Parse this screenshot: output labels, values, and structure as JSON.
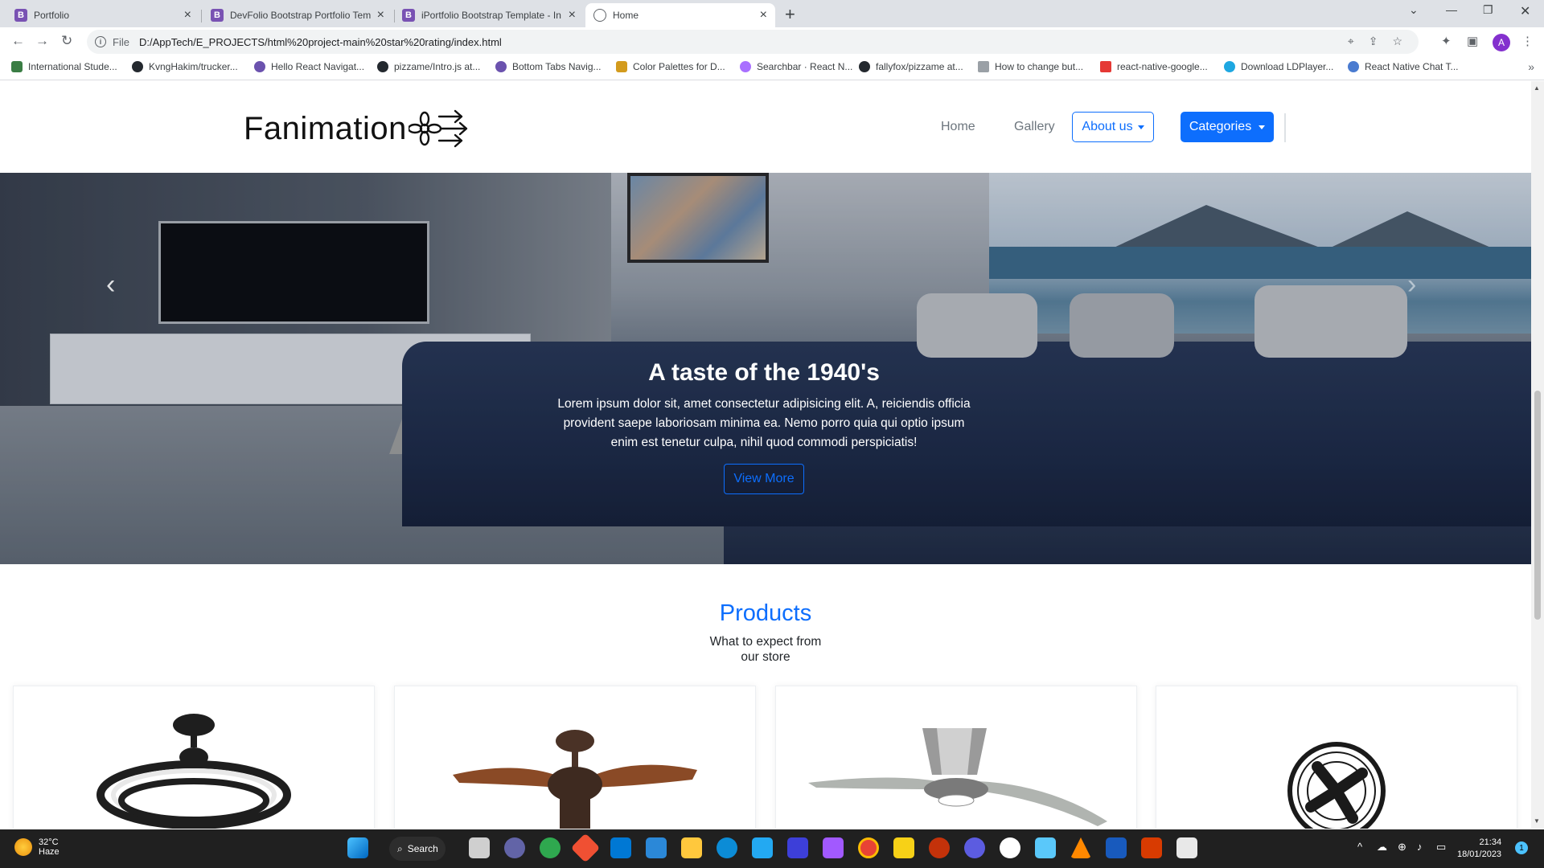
{
  "browser": {
    "tabs": [
      {
        "label": "Portfolio",
        "favicon": "B"
      },
      {
        "label": "DevFolio Bootstrap Portfolio Tem",
        "favicon": "B"
      },
      {
        "label": "iPortfolio Bootstrap Template - In",
        "favicon": "B"
      },
      {
        "label": "Home",
        "favicon": "globe"
      }
    ],
    "new_tab": "+",
    "address": {
      "scheme": "File",
      "url": "D:/AppTech/E_PROJECTS/html%20project-main%20star%20rating/index.html"
    },
    "profile_initial": "A",
    "bookmarks": [
      {
        "label": "International Stude...",
        "color": "#3a7d44"
      },
      {
        "label": "KvngHakim/trucker...",
        "color": "#24292f"
      },
      {
        "label": "Hello React Navigat...",
        "color": "#6b52ae"
      },
      {
        "label": "pizzame/Intro.js at...",
        "color": "#24292f"
      },
      {
        "label": "Bottom Tabs Navig...",
        "color": "#6b52ae"
      },
      {
        "label": "Color Palettes for D...",
        "color": "#d39b1d"
      },
      {
        "label": "Searchbar · React N...",
        "color": "#a970ff"
      },
      {
        "label": "fallyfox/pizzame at...",
        "color": "#24292f"
      },
      {
        "label": "How to change but...",
        "color": "#9aa0a6"
      },
      {
        "label": "react-native-google...",
        "color": "#e53935"
      },
      {
        "label": "Download LDPlayer...",
        "color": "#1ea7e1"
      },
      {
        "label": "React Native Chat T...",
        "color": "#4a7bd0"
      }
    ]
  },
  "site": {
    "brand": "Fanimation",
    "nav": {
      "home": "Home",
      "gallery": "Gallery",
      "about": "About us",
      "categories": "Categories"
    },
    "hero": {
      "title": "A taste of the 1940's",
      "text": "Lorem ipsum dolor sit, amet consectetur adipisicing elit. A, reiciendis officia provident saepe laboriosam minima ea. Nemo porro quia qui optio ipsum enim est tenetur culpa, nihil quod commodi perspiciatis!",
      "button": "View More"
    },
    "products": {
      "heading": "Products",
      "subheading_line1": "What to expect from",
      "subheading_line2": "our store"
    },
    "accent_color": "#0d6efd"
  },
  "taskbar": {
    "weather_temp": "32°C",
    "weather_text": "Haze",
    "search_label": "Search",
    "time": "21:34",
    "date": "18/01/2023",
    "notifications": "1"
  }
}
